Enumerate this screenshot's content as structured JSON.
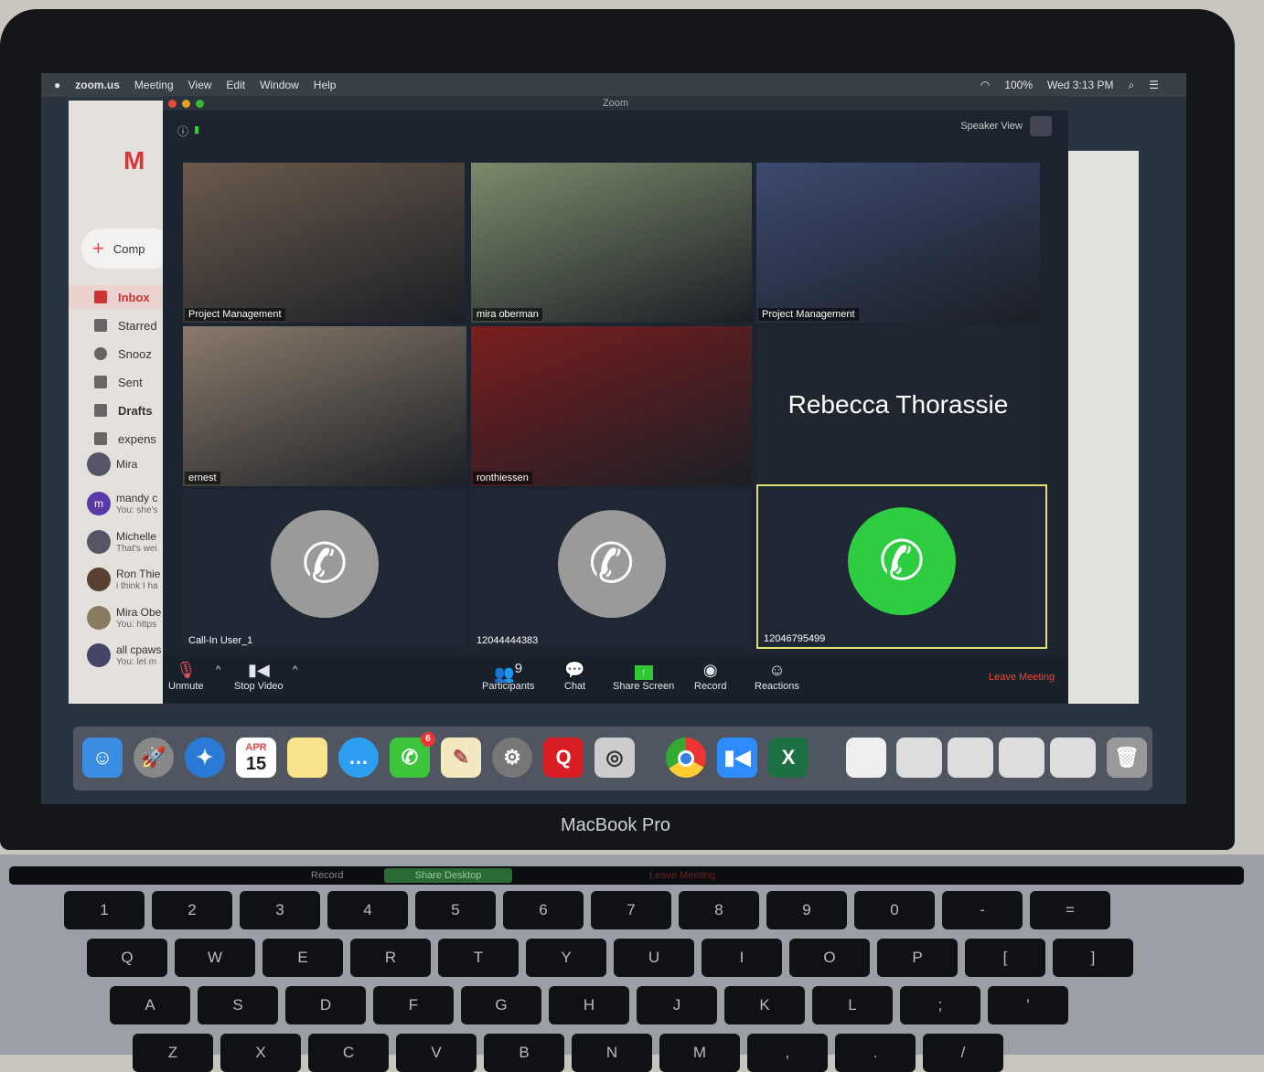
{
  "menubar": {
    "apple": "",
    "app": "zoom.us",
    "items": [
      "Meeting",
      "View",
      "Edit",
      "Window",
      "Help"
    ],
    "battery": "100%",
    "clock": "Wed 3:13 PM"
  },
  "gmail": {
    "compose": "Comp",
    "nav": [
      "Inbox",
      "Starred",
      "Snooz",
      "Sent",
      "Drafts",
      "expens"
    ],
    "user": "Mira",
    "chats": [
      {
        "name": "mandy c",
        "preview": "You: she's",
        "initial": "m"
      },
      {
        "name": "Michelle",
        "preview": "That's wei"
      },
      {
        "name": "Ron Thie",
        "preview": "i think I ha"
      },
      {
        "name": "Mira Obe",
        "preview": "You: https"
      },
      {
        "name": "all cpaws",
        "preview": "You: let m"
      }
    ]
  },
  "zoom": {
    "window_title": "Zoom",
    "view_label": "Speaker View",
    "tiles": [
      {
        "name": "Project Management",
        "type": "video",
        "color": "#6b5a4c"
      },
      {
        "name": "mira oberman",
        "type": "video",
        "color": "#7c8a6a"
      },
      {
        "name": "Project Management",
        "type": "video",
        "color": "#3c4a70"
      },
      {
        "name": "ernest",
        "type": "video",
        "color": "#8a7a6a"
      },
      {
        "name": "ronthiessen",
        "type": "video",
        "color": "#7a1e1e"
      },
      {
        "name": "Rebecca Thorassie",
        "type": "name"
      },
      {
        "name": "Call-In User_1",
        "type": "phone"
      },
      {
        "name": "12044444383",
        "type": "phone"
      },
      {
        "name": "12046795499",
        "type": "phone-active"
      }
    ],
    "toolbar": {
      "unmute": "Unmute",
      "stop_video": "Stop Video",
      "participants": "Participants",
      "participant_count": "9",
      "chat": "Chat",
      "share": "Share Screen",
      "record": "Record",
      "reactions": "Reactions",
      "leave": "Leave Meeting"
    },
    "colors": {
      "active_speaker": "#e0e070",
      "phone_active": "#2ecc40",
      "leave": "#e5483c",
      "share": "#34c534"
    }
  },
  "dock": {
    "calendar_month": "APR",
    "calendar_day": "15",
    "facetime_badge": "6",
    "quicken": "Q",
    "excel": "X",
    "icons": [
      "finder-icon",
      "launchpad-icon",
      "safari-icon",
      "calendar-icon",
      "notes-icon",
      "messages-icon",
      "facetime-icon",
      "textedit-icon",
      "system-preferences-icon",
      "quicken-icon",
      "image-capture-icon",
      "chrome-icon",
      "zoom-icon",
      "excel-icon",
      "document-icon",
      "chrome-window-icon",
      "chrome-window-icon",
      "chrome-window-icon",
      "chrome-window-icon",
      "trash-icon"
    ]
  },
  "laptop": {
    "brand": "MacBook Pro"
  },
  "touchbar": {
    "record": "Record",
    "share": "Share Desktop",
    "leave": "Leave Meeting"
  },
  "keyboard": {
    "rows": [
      [
        "1",
        "2",
        "3",
        "4",
        "5",
        "6",
        "7",
        "8",
        "9",
        "0",
        "-",
        "="
      ],
      [
        "Q",
        "W",
        "E",
        "R",
        "T",
        "Y",
        "U",
        "I",
        "O",
        "P",
        "[",
        "]"
      ],
      [
        "A",
        "S",
        "D",
        "F",
        "G",
        "H",
        "J",
        "K",
        "L",
        ";",
        "'"
      ],
      [
        "Z",
        "X",
        "C",
        "V",
        "B",
        "N",
        "M",
        ",",
        ".",
        "/"
      ]
    ]
  }
}
